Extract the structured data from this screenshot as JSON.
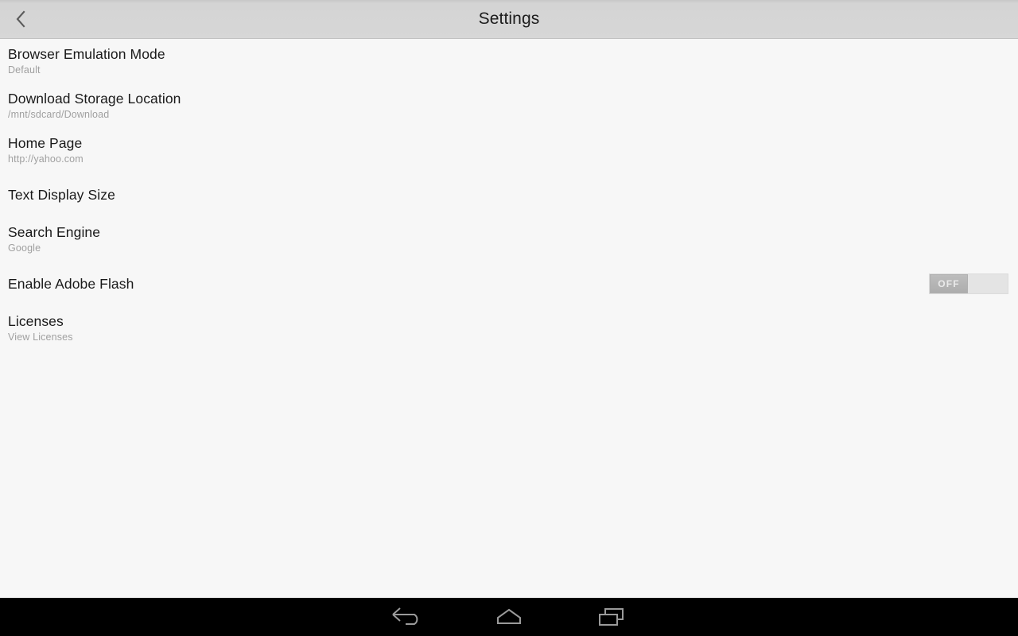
{
  "app": {
    "title": "Settings"
  },
  "actionbar": {
    "title": "Settings",
    "back_icon": "chevron-left-icon"
  },
  "preferences": [
    {
      "key": "browser_emulation_mode",
      "title": "Browser Emulation Mode",
      "summary": "Default",
      "widget": null
    },
    {
      "key": "download_storage_location",
      "title": "Download Storage Location",
      "summary": "/mnt/sdcard/Download",
      "widget": null
    },
    {
      "key": "home_page",
      "title": "Home Page",
      "summary": "http://yahoo.com",
      "widget": null
    },
    {
      "key": "text_display_size",
      "title": "Text Display Size",
      "summary": "",
      "widget": null
    },
    {
      "key": "search_engine",
      "title": "Search Engine",
      "summary": "Google",
      "widget": null
    },
    {
      "key": "enable_adobe_flash",
      "title": "Enable Adobe Flash",
      "summary": "",
      "widget": "switch",
      "switch_state": "OFF",
      "switch_label": "OFF"
    },
    {
      "key": "licenses",
      "title": "Licenses",
      "summary": "View Licenses",
      "widget": null
    }
  ],
  "navbar": {
    "buttons": [
      {
        "key": "back",
        "icon": "back-arrow-icon"
      },
      {
        "key": "home",
        "icon": "home-icon"
      },
      {
        "key": "recents",
        "icon": "recent-apps-icon"
      }
    ]
  },
  "colors": {
    "actionbar_bg": "#d6d6d6",
    "page_bg": "#f7f7f7",
    "title_text": "#1a1a1a",
    "summary_text": "#a0a0a0",
    "navbar_bg": "#000000",
    "nav_icon": "#9a9a9a",
    "switch_track": "#e4e4e4",
    "switch_thumb": "#b4b4b4",
    "switch_label": "#eaeaea"
  }
}
